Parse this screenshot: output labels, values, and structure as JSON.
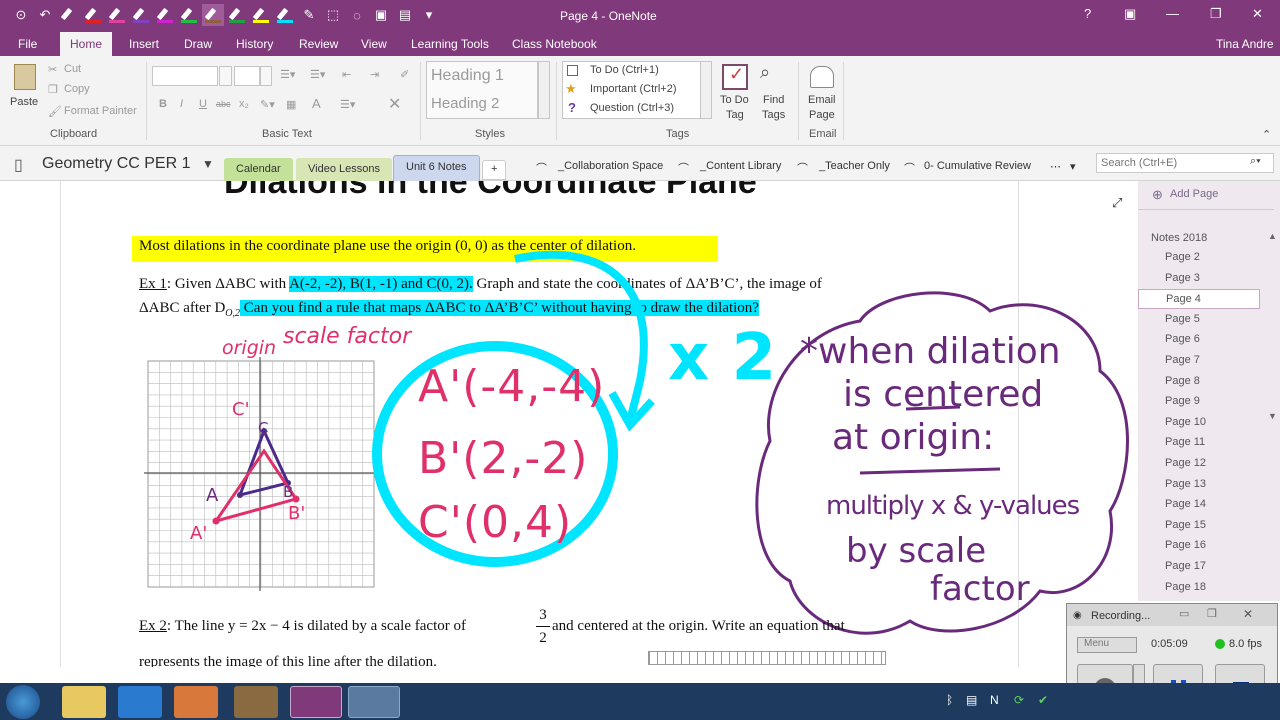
{
  "window": {
    "title": "Page 4 - OneNote",
    "user": "Tina Andre",
    "help": "?"
  },
  "ribbon_tabs": [
    "File",
    "Home",
    "Insert",
    "Draw",
    "History",
    "Review",
    "View",
    "Learning Tools",
    "Class Notebook"
  ],
  "clipboard": {
    "paste": "Paste",
    "cut": "Cut",
    "copy": "Copy",
    "format_painter": "Format Painter",
    "label": "Clipboard"
  },
  "basic_text": {
    "label": "Basic Text",
    "bold": "B",
    "italic": "I",
    "underline": "U",
    "strike": "abc",
    "sub": "x₂",
    "font_a": "A",
    "clear": "✕"
  },
  "styles": {
    "heading1": "Heading 1",
    "heading2": "Heading 2",
    "label": "Styles"
  },
  "tags": {
    "todo": "To Do (Ctrl+1)",
    "important": "Important (Ctrl+2)",
    "question": "Question (Ctrl+3)",
    "label": "Tags",
    "todo_tag": "To Do",
    "todo_tag2": "Tag",
    "find": "Find",
    "find2": "Tags"
  },
  "email": {
    "label": "Email",
    "email_page": "Email",
    "email_page2": "Page"
  },
  "notebook": {
    "name": "Geometry CC PER 1",
    "sections": [
      "Calendar",
      "Video Lessons",
      "Unit 6 Notes",
      "+"
    ],
    "links": [
      "_Collaboration Space",
      "_Content Library",
      "_Teacher Only",
      "0- Cumulative Review"
    ],
    "search_placeholder": "Search (Ctrl+E)"
  },
  "page": {
    "heading": "Dilations in the Coordinate Plane",
    "intro": "Most dilations in the coordinate plane use the origin (0, 0) as the center of dilation.",
    "ex1_label": "Ex 1",
    "ex1_a": ":  Given ΔABC with ",
    "ex1_pts": "A(-2, -2), B(1, -1) and C(0, 2).",
    "ex1_b": "  Graph and state the coordinates of ΔA’B’C’, the image of",
    "ex1_c": "ΔABC after D",
    "ex1_sub": "O,2",
    "ex1_q": "  Can you find a rule that maps ΔABC to ΔA’B’C’ without having to draw the dilation?",
    "ex2_label": "Ex 2",
    "ex2_a": ":  The line  y = 2x − 4  is dilated by a scale factor of",
    "ex2_num": "3",
    "ex2_den": "2",
    "ex2_b": "  and centered at the origin. Write an  equation that",
    "ex2_c": "represents the image of this line after the dilation."
  },
  "ink": {
    "origin": "origin",
    "scale_factor": "scale factor",
    "a1": "A'(-4,-4)",
    "b1": "B'(2,-2)",
    "c1": "C'(0,4)",
    "times2": "x 2",
    "note1": "*when dilation",
    "note2": "is centered",
    "note3": "at origin:",
    "note4": "multiply x & y-values",
    "note5": "by scale",
    "note6": "factor",
    "lbl_A": "A",
    "lbl_Ap": "A'",
    "lbl_B": "B",
    "lbl_Bp": "B'",
    "lbl_C": "C",
    "lbl_Cp": "C'"
  },
  "pages_pane": {
    "add_page": "Add Page",
    "group": "Notes 2018",
    "pages": [
      "Page 2",
      "Page 3",
      "Page 4",
      "Page 5",
      "Page 6",
      "Page 7",
      "Page 8",
      "Page 9",
      "Page 10",
      "Page 11",
      "Page 12",
      "Page 13",
      "Page 14",
      "Page 15",
      "Page 16",
      "Page 17",
      "Page 18"
    ],
    "selected": "Page 4"
  },
  "recorder": {
    "title": "Recording...",
    "menu": "Menu",
    "time": "0:05:09",
    "fps": "8.0 fps"
  },
  "colors": {
    "accent": "#80397b",
    "yellow": "#ffff00",
    "cyan": "#00e5ff",
    "ink_pink": "#e0306a",
    "ink_purple": "#6a2a7c"
  }
}
